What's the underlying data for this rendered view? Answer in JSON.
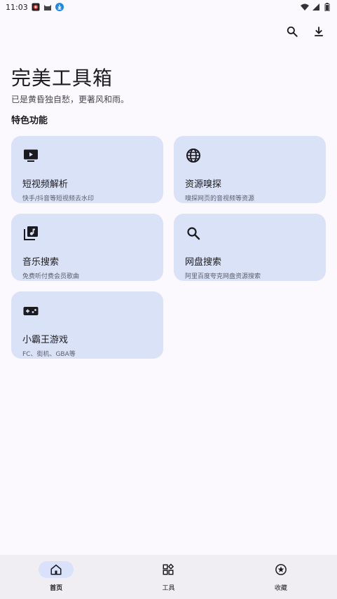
{
  "status_bar": {
    "time": "11:03"
  },
  "header": {
    "title": "完美工具箱",
    "subtitle": "已是黄昏独自愁，更著风和雨。",
    "section_title": "特色功能"
  },
  "toolbar": {
    "search_icon": "search-icon",
    "download_icon": "download-icon"
  },
  "features": [
    {
      "title": "短视频解析",
      "desc": "快手/抖音等短视频去水印",
      "icon": "video-icon"
    },
    {
      "title": "资源嗅探",
      "desc": "嗅探网页的音视频等资源",
      "icon": "globe-icon"
    },
    {
      "title": "音乐搜索",
      "desc": "免费听付费会员歌曲",
      "icon": "music-library-icon"
    },
    {
      "title": "网盘搜索",
      "desc": "阿里百度夸克网盘资源搜索",
      "icon": "search-icon"
    },
    {
      "title": "小霸王游戏",
      "desc": "FC、街机、GBA等",
      "icon": "gamepad-icon"
    }
  ],
  "bottom_nav": [
    {
      "label": "首页",
      "icon": "home-icon",
      "active": true
    },
    {
      "label": "工具",
      "icon": "widgets-icon",
      "active": false
    },
    {
      "label": "收藏",
      "icon": "star-icon",
      "active": false
    }
  ],
  "colors": {
    "background": "#fcf9fe",
    "card": "#dae2f8",
    "nav_bar": "#f0edf3",
    "nav_active": "#d9e2fa"
  }
}
